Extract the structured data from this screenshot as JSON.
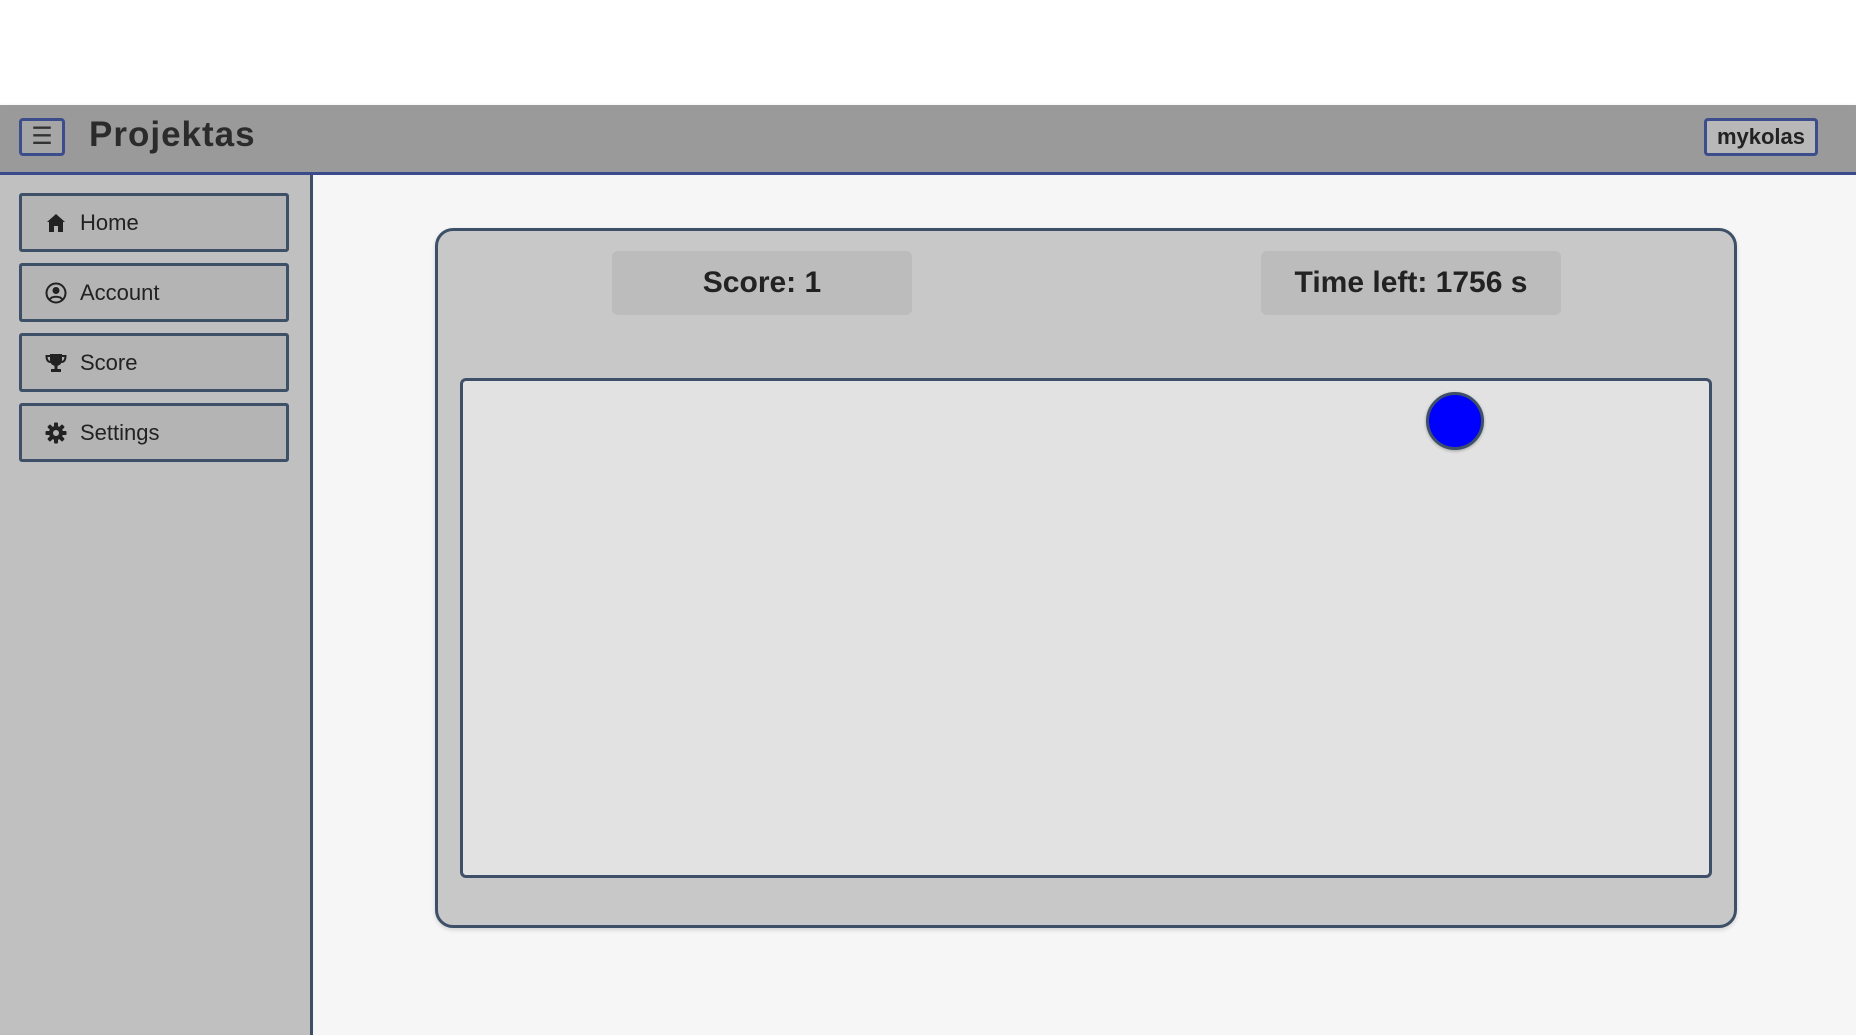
{
  "header": {
    "menu_icon": "hamburger-menu-icon",
    "title": "Projektas",
    "username": "mykolas"
  },
  "sidebar": {
    "items": [
      {
        "label": "Home",
        "icon": "home-icon"
      },
      {
        "label": "Account",
        "icon": "user-circle-icon"
      },
      {
        "label": "Score",
        "icon": "trophy-icon"
      },
      {
        "label": "Settings",
        "icon": "gear-icon"
      }
    ]
  },
  "game": {
    "score_text": "Score: 1",
    "time_text": "Time left: 1756 s",
    "target_color": "#0000ff"
  },
  "colors": {
    "topbar": "#9a9a9a",
    "accent_border": "#3c4d8c",
    "sidebar": "#c0c0c0",
    "card": "#c8c8c8",
    "play_area": "#e2e2e2"
  }
}
